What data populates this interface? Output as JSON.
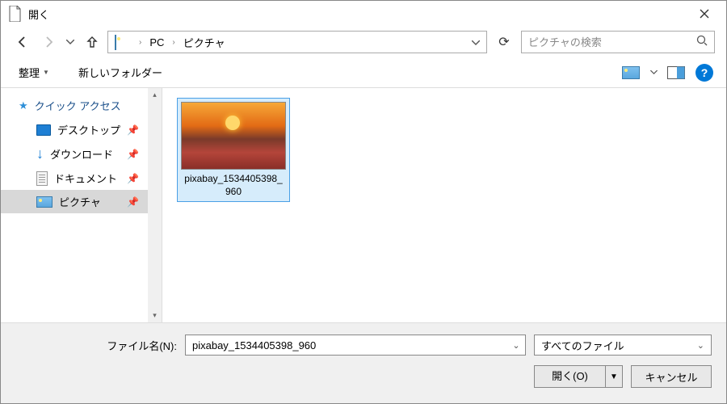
{
  "title": "開く",
  "breadcrumb": {
    "root": "PC",
    "folder": "ピクチャ"
  },
  "search": {
    "placeholder": "ピクチャの検索"
  },
  "toolbar": {
    "organize": "整理",
    "newfolder": "新しいフォルダー"
  },
  "sidebar": {
    "quick_access": "クイック アクセス",
    "items": [
      {
        "label": "デスクトップ"
      },
      {
        "label": "ダウンロード"
      },
      {
        "label": "ドキュメント"
      },
      {
        "label": "ピクチャ"
      }
    ]
  },
  "files": [
    {
      "name": "pixabay_1534405398_960"
    }
  ],
  "bottom": {
    "filename_label": "ファイル名(N):",
    "filename_value": "pixabay_1534405398_960",
    "filter": "すべてのファイル",
    "open": "開く(O)",
    "cancel": "キャンセル"
  }
}
